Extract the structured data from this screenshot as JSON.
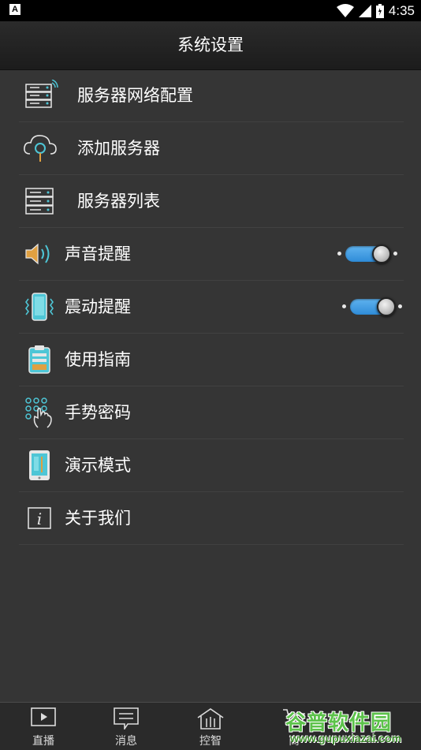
{
  "status_bar": {
    "time": "4:35",
    "notification_glyph": "A"
  },
  "header": {
    "title": "系统设置"
  },
  "settings": [
    {
      "label": "服务器网络配置",
      "icon": "server-network-icon"
    },
    {
      "label": "添加服务器",
      "icon": "cloud-search-icon"
    },
    {
      "label": "服务器列表",
      "icon": "server-list-icon"
    },
    {
      "label": "声音提醒",
      "icon": "speaker-icon",
      "toggle_on": true
    },
    {
      "label": "震动提醒",
      "icon": "vibrate-phone-icon",
      "toggle_on": true
    },
    {
      "label": "使用指南",
      "icon": "clipboard-guide-icon"
    },
    {
      "label": "手势密码",
      "icon": "gesture-password-icon"
    },
    {
      "label": "演示模式",
      "icon": "demo-tablet-icon"
    },
    {
      "label": "关于我们",
      "icon": "info-icon"
    }
  ],
  "tabs": [
    {
      "label": "直播",
      "icon": "play-icon"
    },
    {
      "label": "消息",
      "icon": "message-icon"
    },
    {
      "label": "控智",
      "icon": "home-control-icon"
    },
    {
      "label": "商",
      "icon": "cart-icon"
    }
  ],
  "watermark": {
    "text": "谷普软件园",
    "url": "www.gupuxiazai.com"
  },
  "colors": {
    "accent": "#3a9ae3",
    "icon_teal": "#4ec6d6",
    "background": "#353535"
  }
}
